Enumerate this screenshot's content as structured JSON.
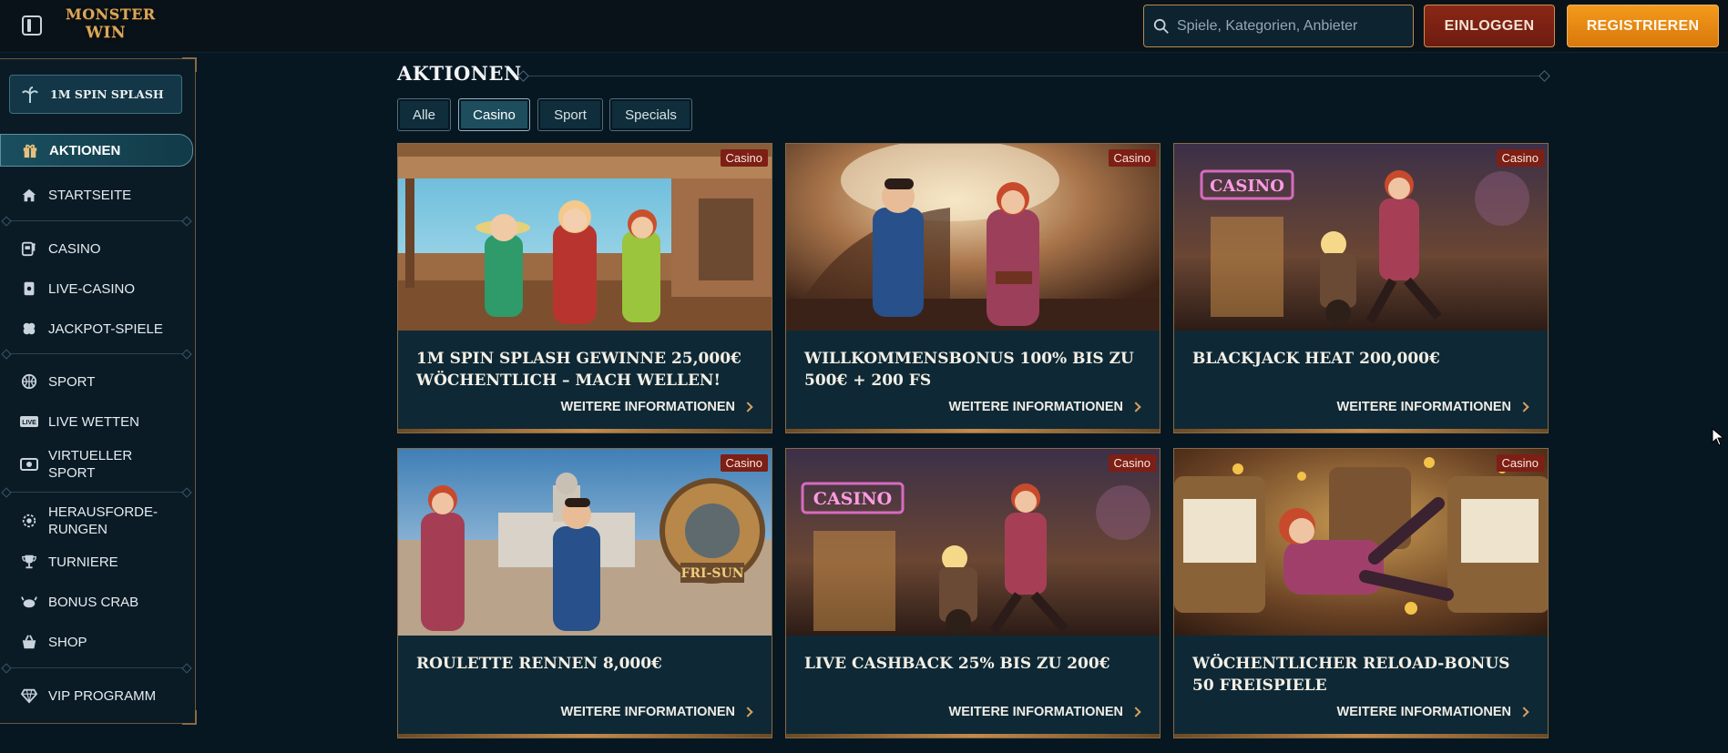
{
  "header": {
    "logo_line1": "MONSTER",
    "logo_line2": "WIN",
    "search_placeholder": "Spiele, Kategorien, Anbieter",
    "login_label": "EINLOGGEN",
    "register_label": "REGISTRIEREN"
  },
  "sidebar": {
    "promo_chip": "1M SPIN SPLASH",
    "items": [
      {
        "label": "AKTIONEN",
        "icon": "gift-icon",
        "active": true
      },
      {
        "label": "STARTSEITE",
        "icon": "home-icon"
      },
      {
        "label": "CASINO",
        "icon": "slot-machine-icon"
      },
      {
        "label": "LIVE-CASINO",
        "icon": "playing-card-icon"
      },
      {
        "label": "JACKPOT-SPIELE",
        "icon": "clover-icon"
      },
      {
        "label": "SPORT",
        "icon": "basketball-icon"
      },
      {
        "label": "LIVE WETTEN",
        "icon": "live-badge-icon"
      },
      {
        "label": "VIRTUELLER",
        "label2": "SPORT",
        "icon": "virtual-sport-icon"
      },
      {
        "label": "HERAUSFORDE-",
        "label2": "RUNGEN",
        "icon": "challenge-icon"
      },
      {
        "label": "TURNIERE",
        "icon": "trophy-icon"
      },
      {
        "label": "BONUS CRAB",
        "icon": "crab-icon"
      },
      {
        "label": "SHOP",
        "icon": "shopping-basket-icon"
      },
      {
        "label": "VIP PROGRAMM",
        "icon": "diamond-icon"
      }
    ]
  },
  "main": {
    "section_title": "AKTIONEN",
    "filters": [
      "Alle",
      "Casino",
      "Sport",
      "Specials"
    ],
    "active_filter": "Casino",
    "more_label": "WEITERE INFORMATIONEN",
    "cards": [
      {
        "badge": "Casino",
        "title": "1M Spin Splash Gewinne 25,000€ wöchentlich – Mach Wellen!",
        "scene": "beach"
      },
      {
        "badge": "Casino",
        "title": "Willkommensbonus 100% bis zu 500€ + 200 FS",
        "scene": "hall"
      },
      {
        "badge": "Casino",
        "title": "Blackjack Heat 200,000€",
        "scene": "casino"
      },
      {
        "badge": "Casino",
        "title": "Roulette Rennen 8,000€",
        "scene": "plaza"
      },
      {
        "badge": "Casino",
        "title": "Live Cashback 25% bis zu 200€",
        "scene": "casino"
      },
      {
        "badge": "Casino",
        "title": "Wöchentlicher Reload-Bonus 50 Freispiele",
        "scene": "slots"
      }
    ]
  },
  "colors": {
    "background": "#071722",
    "accent_gold": "#c48a4d",
    "login_red": "#8a2716",
    "register_orange": "#f39a1c",
    "badge_red": "#7d1f15"
  }
}
